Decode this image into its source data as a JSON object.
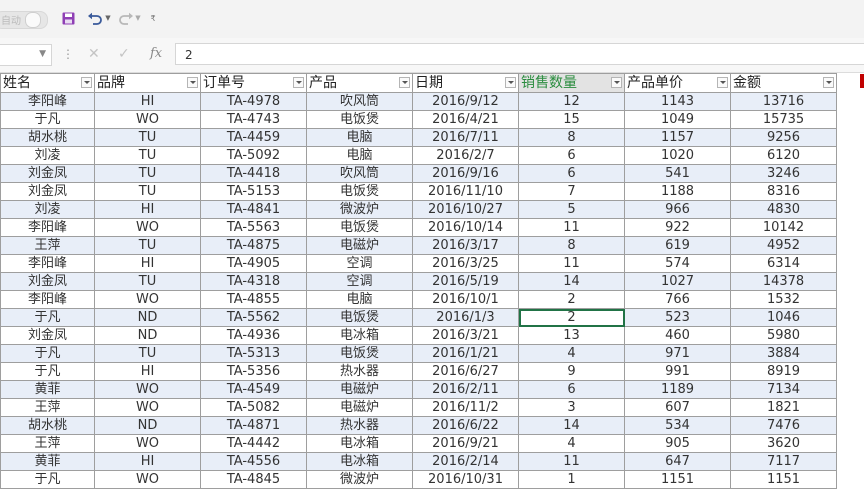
{
  "toolbar": {
    "toggle_text": "自动",
    "icons": [
      "save-icon",
      "undo-icon",
      "redo-icon",
      "customize-icon"
    ],
    "colors": {
      "save": "#8f3fb5",
      "undo": "#3a5a9a"
    }
  },
  "formula_bar": {
    "namebox_value": "",
    "fx_label": "fx",
    "content": "2"
  },
  "sheet": {
    "headers": [
      "姓名",
      "品牌",
      "订单号",
      "产品",
      "日期",
      "销售数量",
      "产品单价",
      "金额"
    ],
    "active_column": 5,
    "selected_cell": {
      "row": 12,
      "col": 5
    },
    "rows": [
      [
        "李阳峰",
        "HI",
        "TA-4978",
        "吹风筒",
        "2016/9/12",
        "12",
        "1143",
        "13716"
      ],
      [
        "于凡",
        "WO",
        "TA-4743",
        "电饭煲",
        "2016/4/21",
        "15",
        "1049",
        "15735"
      ],
      [
        "胡水桃",
        "TU",
        "TA-4459",
        "电脑",
        "2016/7/11",
        "8",
        "1157",
        "9256"
      ],
      [
        "刘凌",
        "TU",
        "TA-5092",
        "电脑",
        "2016/2/7",
        "6",
        "1020",
        "6120"
      ],
      [
        "刘金凤",
        "TU",
        "TA-4418",
        "吹风筒",
        "2016/9/16",
        "6",
        "541",
        "3246"
      ],
      [
        "刘金凤",
        "TU",
        "TA-5153",
        "电饭煲",
        "2016/11/10",
        "7",
        "1188",
        "8316"
      ],
      [
        "刘凌",
        "HI",
        "TA-4841",
        "微波炉",
        "2016/10/27",
        "5",
        "966",
        "4830"
      ],
      [
        "李阳峰",
        "WO",
        "TA-5563",
        "电饭煲",
        "2016/10/14",
        "11",
        "922",
        "10142"
      ],
      [
        "王萍",
        "TU",
        "TA-4875",
        "电磁炉",
        "2016/3/17",
        "8",
        "619",
        "4952"
      ],
      [
        "李阳峰",
        "HI",
        "TA-4905",
        "空调",
        "2016/3/25",
        "11",
        "574",
        "6314"
      ],
      [
        "刘金凤",
        "TU",
        "TA-4318",
        "空调",
        "2016/5/19",
        "14",
        "1027",
        "14378"
      ],
      [
        "李阳峰",
        "WO",
        "TA-4855",
        "电脑",
        "2016/10/1",
        "2",
        "766",
        "1532"
      ],
      [
        "于凡",
        "ND",
        "TA-5562",
        "电饭煲",
        "2016/1/3",
        "2",
        "523",
        "1046"
      ],
      [
        "刘金凤",
        "ND",
        "TA-4936",
        "电冰箱",
        "2016/3/21",
        "13",
        "460",
        "5980"
      ],
      [
        "于凡",
        "TU",
        "TA-5313",
        "电饭煲",
        "2016/1/21",
        "4",
        "971",
        "3884"
      ],
      [
        "于凡",
        "HI",
        "TA-5356",
        "热水器",
        "2016/6/27",
        "9",
        "991",
        "8919"
      ],
      [
        "黄菲",
        "WO",
        "TA-4549",
        "电磁炉",
        "2016/2/11",
        "6",
        "1189",
        "7134"
      ],
      [
        "王萍",
        "WO",
        "TA-5082",
        "电磁炉",
        "2016/11/2",
        "3",
        "607",
        "1821"
      ],
      [
        "胡水桃",
        "ND",
        "TA-4871",
        "热水器",
        "2016/6/22",
        "14",
        "534",
        "7476"
      ],
      [
        "王萍",
        "WO",
        "TA-4442",
        "电冰箱",
        "2016/9/21",
        "4",
        "905",
        "3620"
      ],
      [
        "黄菲",
        "HI",
        "TA-4556",
        "电冰箱",
        "2016/2/14",
        "11",
        "647",
        "7117"
      ],
      [
        "于凡",
        "WO",
        "TA-4845",
        "微波炉",
        "2016/10/31",
        "1",
        "1151",
        "1151"
      ]
    ]
  }
}
